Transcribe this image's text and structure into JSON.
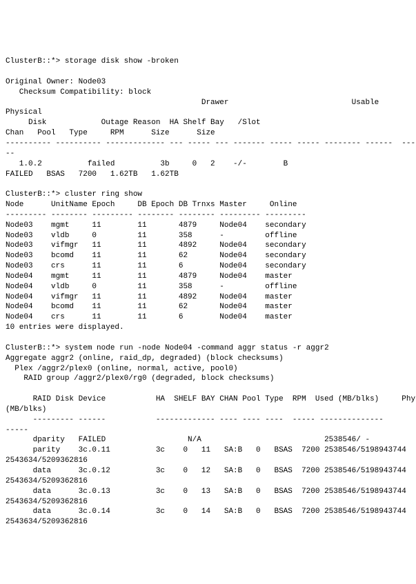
{
  "cmd1": {
    "prompt": "ClusterB::*> storage disk show -broken",
    "owner_line": "Original Owner: Node03",
    "checksum_line": "   Checksum Compatibility: block",
    "hdr_drawer_usable": "                                           Drawer                           Usable",
    "hdr_physical": "Physical",
    "hdr_disk": "     Disk            Outage Reason  HA Shelf Bay   /Slot",
    "hdr_chan": "Chan   Pool   Type     RPM      Size      Size",
    "sep1": "---------- ---------- ------------- --- ----- --- ------- ----- ----- -------- ------  -----",
    "sep2": "--",
    "row1_a": "   1.0.2          failed          3b     0   2    -/-        B",
    "row1_b": "FAILED   BSAS   7200   1.62TB   1.62TB"
  },
  "cmd2": {
    "prompt": "ClusterB::*> cluster ring show",
    "hdr": "Node      UnitName Epoch     DB Epoch DB Trnxs Master     Online",
    "sep": "--------- -------- --------- -------- -------- --------- ---------",
    "rows": [
      "Node03    mgmt     11        11       4879     Node04    secondary",
      "Node03    vldb     0         11       358      -         offline",
      "Node03    vifmgr   11        11       4892     Node04    secondary",
      "Node03    bcomd    11        11       62       Node04    secondary",
      "Node03    crs      11        11       6        Node04    secondary",
      "Node04    mgmt     11        11       4879     Node04    master",
      "Node04    vldb     0         11       358      -         offline",
      "Node04    vifmgr   11        11       4892     Node04    master",
      "Node04    bcomd    11        11       62       Node04    master",
      "Node04    crs      11        11       6        Node04    master"
    ],
    "footer": "10 entries were displayed."
  },
  "cmd3": {
    "prompt": "ClusterB::*> system node run -node Node04 -command aggr status -r aggr2",
    "l1": "Aggregate aggr2 (online, raid_dp, degraded) (block checksums)",
    "l2": "  Plex /aggr2/plex0 (online, normal, active, pool0)",
    "l3": "    RAID group /aggr2/plex0/rg0 (degraded, block checksums)",
    "hdr1": "      RAID Disk Device           HA  SHELF BAY CHAN Pool Type  RPM  Used (MB/blks)     Phys",
    "hdr2": "(MB/blks)",
    "sep": "      --------- ------           ------------- ---- ---- ----  ----- --------------",
    "sep2": "-----",
    "rows": [
      {
        "a": "      dparity   FAILED                  N/A                           2538546/ -",
        "b": ""
      },
      {
        "a": "      parity    3c.0.11          3c    0   11   SA:B   0   BSAS  7200 2538546/5198943744",
        "b": "2543634/5209362816"
      },
      {
        "a": "      data      3c.0.12          3c    0   12   SA:B   0   BSAS  7200 2538546/5198943744",
        "b": "2543634/5209362816"
      },
      {
        "a": "      data      3c.0.13          3c    0   13   SA:B   0   BSAS  7200 2538546/5198943744",
        "b": "2543634/5209362816"
      },
      {
        "a": "      data      3c.0.14          3c    0   14   SA:B   0   BSAS  7200 2538546/5198943744",
        "b": "2543634/5209362816"
      }
    ]
  }
}
